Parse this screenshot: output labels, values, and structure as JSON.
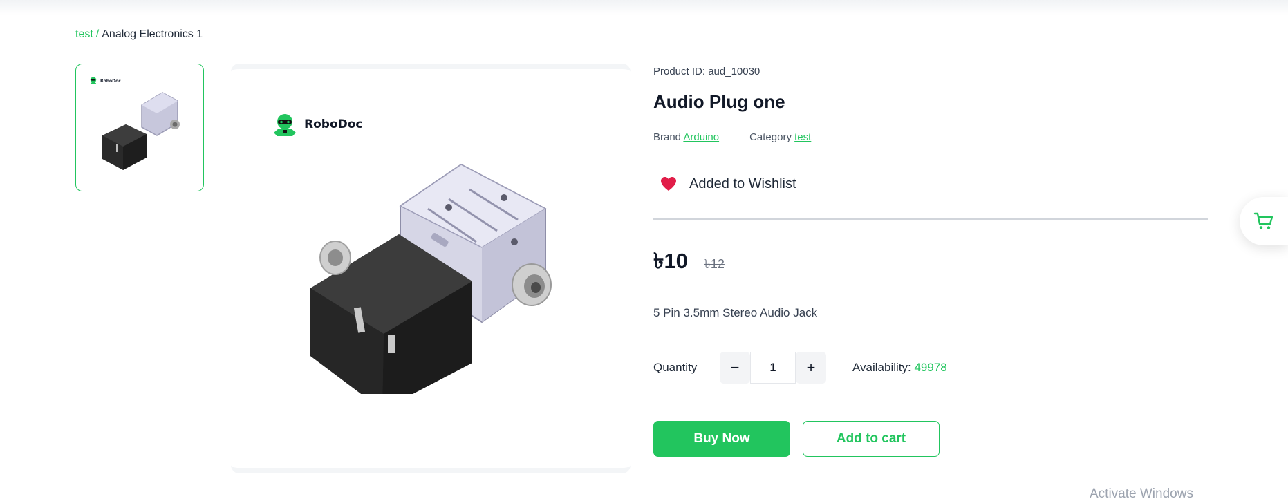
{
  "breadcrumb": {
    "link": "test",
    "separator": "/",
    "current": "Analog Electronics 1"
  },
  "gallery": {
    "thumbnail_logo_text": "RoboDoc",
    "main_logo_text": "RoboDoc"
  },
  "product": {
    "id_text": "Product ID: aud_10030",
    "title": "Audio Plug one",
    "brand_label": "Brand",
    "brand_value": "Arduino",
    "category_label": "Category",
    "category_value": "test",
    "wishlist_text": "Added to Wishlist",
    "price_current": "৳10",
    "price_old": "৳12",
    "description": "5 Pin 3.5mm Stereo Audio Jack",
    "quantity_label": "Quantity",
    "quantity_value": "1",
    "decrement_symbol": "−",
    "increment_symbol": "+",
    "availability_label": "Availability:",
    "availability_value": "49978"
  },
  "actions": {
    "buy_now": "Buy Now",
    "add_to_cart": "Add to cart"
  },
  "icons": {
    "wishlist": "heart-icon",
    "floating_cart": "shopping-cart-icon"
  },
  "colors": {
    "accent": "#22c55e",
    "heart": "#e11d48"
  },
  "os_overlay": {
    "watermark": "Activate Windows"
  }
}
